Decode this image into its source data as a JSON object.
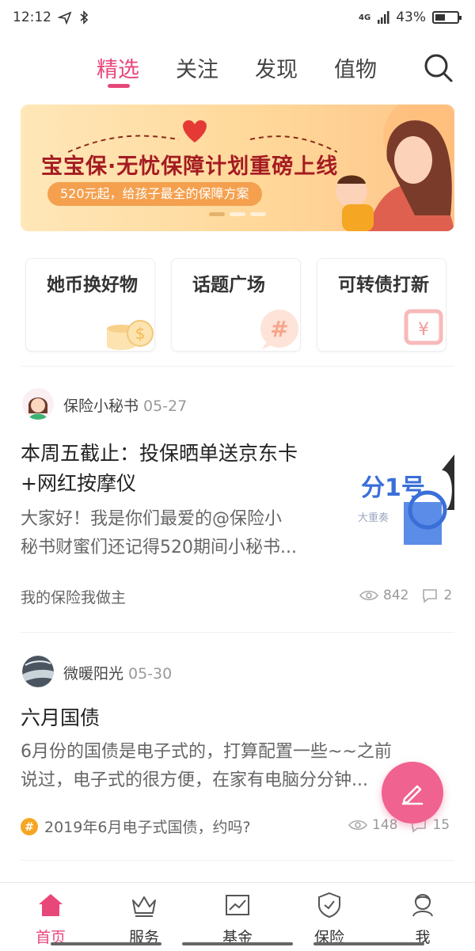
{
  "status_bar": {
    "time": "12:12",
    "network": "4G",
    "battery": "43%"
  },
  "tabs": [
    {
      "label": "精选",
      "active": true
    },
    {
      "label": "关注",
      "active": false
    },
    {
      "label": "发现",
      "active": false
    },
    {
      "label": "值物",
      "active": false
    }
  ],
  "banner": {
    "title": "宝宝保·无忧保障计划重磅上线",
    "subtitle": "520元起，给孩子最全的保障方案"
  },
  "quick_links": [
    {
      "label": "她币换好物",
      "icon": "coins-icon"
    },
    {
      "label": "话题广场",
      "icon": "hashtag-bubble-icon"
    },
    {
      "label": "可转债打新",
      "icon": "yen-icon"
    }
  ],
  "posts": [
    {
      "author": "保险小秘书",
      "date": "05-27",
      "title_lines": [
        "本周五截止：投保晒单送京东卡",
        "+网红按摩仪"
      ],
      "excerpt_lines": [
        "大家好！我是你们最爱的@保险小",
        "秘书财蜜们还记得520期间小秘书..."
      ],
      "topic": "我的保险我做主",
      "views": "842",
      "comments": "2",
      "thumb_text": [
        "分1号",
        "大重奏"
      ]
    },
    {
      "author": "微暖阳光",
      "date": "05-30",
      "title_lines": [
        "六月国债"
      ],
      "excerpt_lines": [
        "6月份的国债是电子式的，打算配置一些~~之前",
        "说过，电子式的很方便，在家有电脑分分钟..."
      ],
      "topic": "2019年6月电子式国债，约吗?",
      "views": "148",
      "comments": "15"
    }
  ],
  "bottom_nav": [
    {
      "label": "首页",
      "icon": "home-icon",
      "active": true
    },
    {
      "label": "服务",
      "icon": "crown-icon",
      "active": false
    },
    {
      "label": "基金",
      "icon": "chart-icon",
      "active": false
    },
    {
      "label": "保险",
      "icon": "shield-icon",
      "active": false
    },
    {
      "label": "我",
      "icon": "user-icon",
      "active": false
    }
  ],
  "colors": {
    "accent": "#e8477a",
    "fab": "#f0628f",
    "banner_title": "#a41c22"
  }
}
